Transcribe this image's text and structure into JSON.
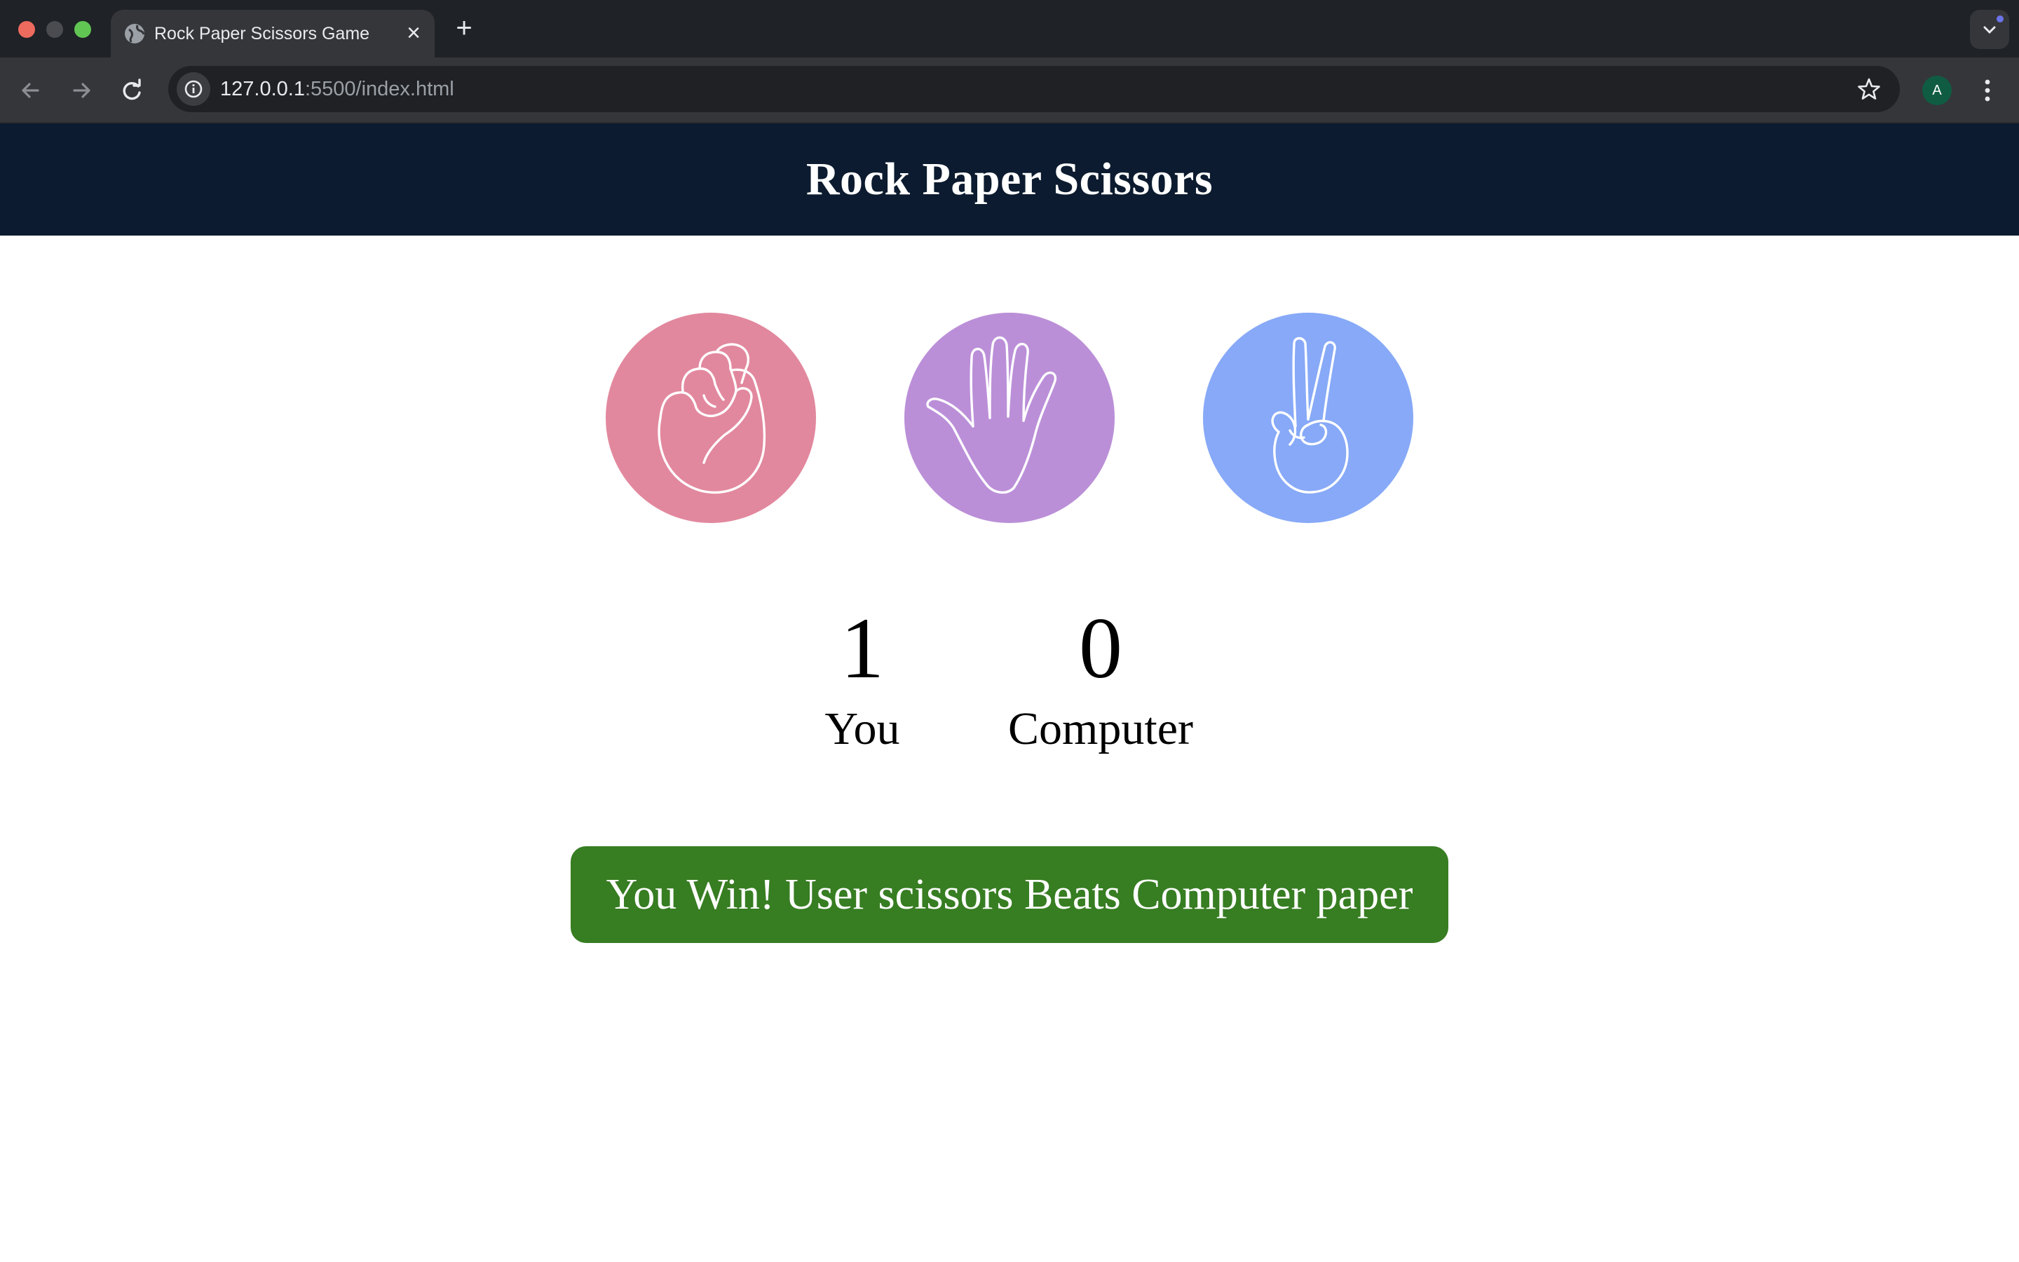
{
  "browser": {
    "tab_title": "Rock Paper Scissors Game",
    "url_host": "127.0.0.1",
    "url_path": ":5500/index.html",
    "profile_initial": "A"
  },
  "page": {
    "title": "Rock Paper Scissors",
    "choices": [
      {
        "name": "rock",
        "color": "#e2889e",
        "icon": "fist-icon"
      },
      {
        "name": "paper",
        "color": "#bb8fd8",
        "icon": "open-hand-icon"
      },
      {
        "name": "scissors",
        "color": "#87a9f7",
        "icon": "peace-hand-icon"
      }
    ],
    "score": {
      "user_score": "1",
      "user_label": "You",
      "computer_score": "0",
      "computer_label": "Computer"
    },
    "result": {
      "message": "You Win! User scissors Beats Computer paper",
      "color": "#377d22"
    }
  }
}
